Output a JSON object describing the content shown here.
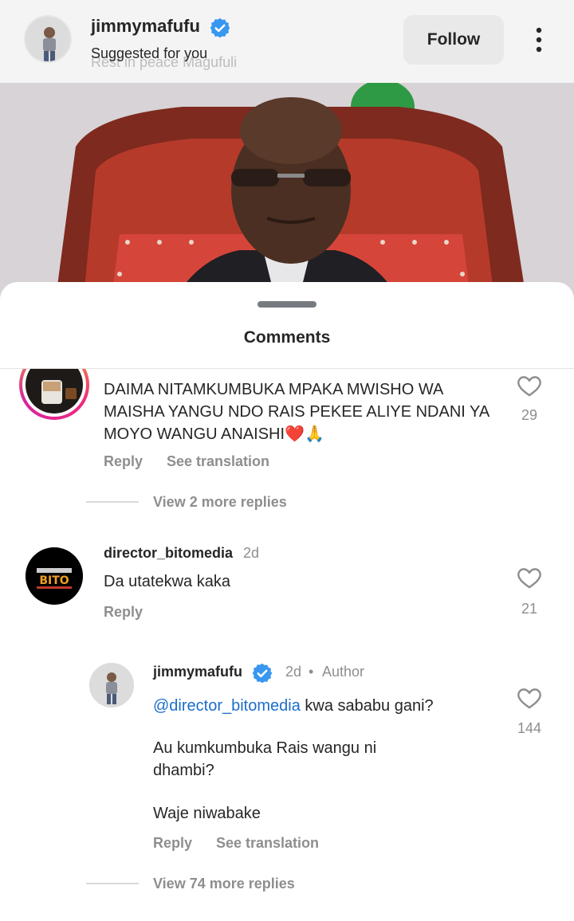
{
  "post": {
    "username": "jimmymafufu",
    "subtitle": "Suggested for you",
    "faded_caption": "Rest in peace Magufuli",
    "follow_label": "Follow"
  },
  "sheet": {
    "title": "Comments"
  },
  "comments": [
    {
      "text": "DAIMA NITAMKUMBUKA MPAKA MWISHO WA MAISHA YANGU NDO RAIS PEKEE ALIYE NDANI YA MOYO WANGU ANAISHI❤️🙏",
      "likes": "29",
      "reply_label": "Reply",
      "translate_label": "See translation",
      "view_replies": "View 2 more replies"
    },
    {
      "username": "director_bitomedia",
      "time": "2d",
      "text": "Da utatekwa kaka",
      "likes": "21",
      "reply_label": "Reply"
    },
    {
      "username": "jimmymafufu",
      "time": "2d",
      "author_label": "Author",
      "mention": "@director_bitomedia",
      "text_line1": "kwa sababu gani?",
      "text_line2": "Au kumkumbuka Rais wangu ni dhambi?",
      "text_line3": "Waje niwabake",
      "likes": "144",
      "reply_label": "Reply",
      "translate_label": "See translation",
      "view_replies": "View 74 more replies"
    }
  ],
  "icons": {
    "verified": "verified-badge-icon",
    "like": "heart-outline-icon",
    "more": "more-vertical-icon"
  },
  "colors": {
    "verified": "#3897f0",
    "mention": "#1c6ecb",
    "secondary_text": "#8e8e8e",
    "story_ring_start": "#f9a825",
    "story_ring_end": "#d6249f"
  }
}
